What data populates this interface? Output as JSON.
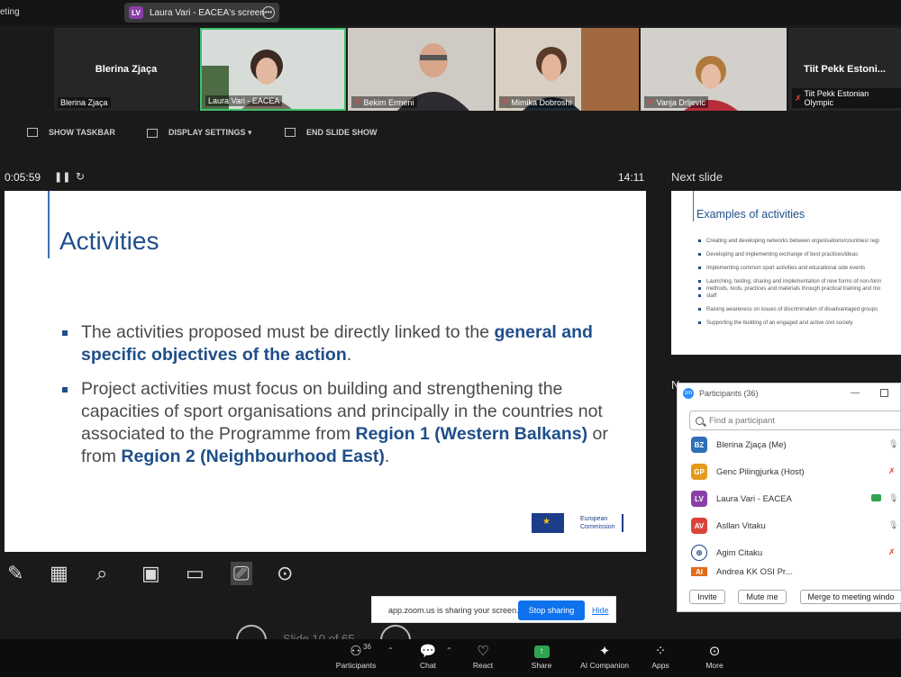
{
  "app": {
    "title": "eting"
  },
  "screen_share": {
    "badge": "LV",
    "label": "Laura Vari - EACEA's screen"
  },
  "tiles": [
    {
      "center_name": "Blerina Zjaça",
      "label": "Blerina Zjaça",
      "muted": false
    },
    {
      "label": "Laura Vari - EACEA",
      "muted": false
    },
    {
      "label": "Bekim Ermeni",
      "muted": true
    },
    {
      "label": "Mimika Dobroshi",
      "muted": true
    },
    {
      "label": "Vanja Drljevic",
      "muted": true
    },
    {
      "center_name": "Tiit Pekk Estoni...",
      "label": "Tiit Pekk Estonian Olympic",
      "muted": true
    }
  ],
  "slideshow": {
    "show_taskbar": "SHOW TASKBAR",
    "display_settings": "DISPLAY SETTINGS ▾",
    "end_slide_show": "END SLIDE SHOW",
    "elapsed": "0:05:59",
    "clock": "14:11",
    "next_slide_label": "Next slide",
    "notes_label": "N",
    "slide_counter": "Slide 10 of 65"
  },
  "slide": {
    "title": "Activities",
    "b1_a": "The activities proposed must be directly linked to the ",
    "b1_b": "general and specific objectives of the action",
    "b1_c": ".",
    "b2_a": "Project activities must focus on building and strengthening the capacities of sport organisations and principally in the countries not associated to the Programme from ",
    "b2_b": "Region 1 (Western Balkans)",
    "b2_c": " or from ",
    "b2_d": "Region 2 (Neighbourhood East)",
    "b2_e": ".",
    "logo_line1": "European",
    "logo_line2": "Commission"
  },
  "next_slide": {
    "title": "Examples of activities",
    "items": [
      "Creating and developing networks between organisations/countries/ regi",
      "Developing and implementing exchange of best practices/ideas",
      "Implementing common sport activities and educational side events",
      "Launching, testing, sharing and implementation of new forms of non-form",
      "methods, tools, practices and materials through practical training and mo",
      "staff",
      "Raising awareness on issues of discrimination of disadvantaged groups",
      "Supporting the building of an engaged and active civil society"
    ]
  },
  "participants": {
    "title": "Participants (36)",
    "search_placeholder": "Find a participant",
    "list": [
      {
        "initials": "BZ",
        "name": "Blerina Zjaça (Me)",
        "color": "#2e6fb5",
        "muted": false,
        "video": false
      },
      {
        "initials": "GP",
        "name": "Genc Pilingjurka (Host)",
        "color": "#e59a1c",
        "muted": true,
        "video": false
      },
      {
        "initials": "LV",
        "name": "Laura Vari - EACEA",
        "color": "#8a3fa8",
        "muted": false,
        "video": true
      },
      {
        "initials": "AV",
        "name": "Asllan Vitaku",
        "color": "#d9443a",
        "muted": false,
        "video": false
      },
      {
        "initials": "",
        "name": "Agim Citaku",
        "color": "#1c3d8a",
        "muted": true,
        "video": false
      },
      {
        "initials": "AI",
        "name": "Andrea KK OSI Pr...",
        "color": "#e06b1c",
        "muted": true,
        "video": false
      }
    ],
    "invite": "Invite",
    "mute_me": "Mute me",
    "merge": "Merge to meeting windo"
  },
  "share_notice": {
    "text": "app.zoom.us is sharing your screen.",
    "stop": "Stop sharing",
    "hide": "Hide"
  },
  "bottom_bar": {
    "participants_count": "36",
    "participants": "Participants",
    "chat": "Chat",
    "react": "React",
    "share": "Share",
    "ai": "AI Companion",
    "apps": "Apps",
    "more": "More"
  }
}
